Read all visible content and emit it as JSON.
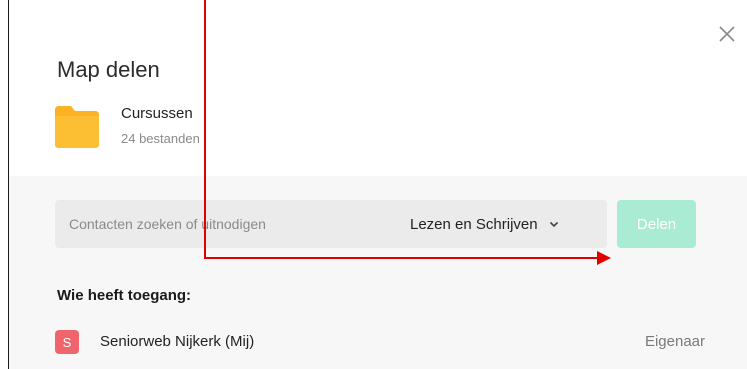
{
  "dialog": {
    "title": "Map delen",
    "close_icon": "close-icon"
  },
  "folder": {
    "icon": "folder-icon",
    "icon_color": "#fbb324",
    "name": "Cursussen",
    "count": "24 bestanden"
  },
  "share": {
    "search_placeholder": "Contacten zoeken of uitnodigen",
    "search_value": "",
    "permission": "Lezen en Schrijven",
    "button_label": "Delen",
    "button_color": "#a9ecd3"
  },
  "access": {
    "title": "Wie heeft toegang:",
    "members": [
      {
        "initial": "S",
        "name": "Seniorweb Nijkerk (Mij)",
        "role": "Eigenaar",
        "avatar_color": "#f0646b"
      }
    ]
  },
  "annotation": {
    "color": "#e00000"
  }
}
